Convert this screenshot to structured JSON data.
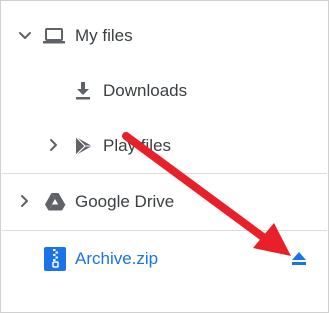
{
  "nav": {
    "my_files": {
      "label": "My files",
      "icon": "laptop-icon",
      "expanded": true
    },
    "downloads": {
      "label": "Downloads",
      "icon": "download-icon"
    },
    "play_files": {
      "label": "Play files",
      "icon": "play-store-icon",
      "expanded": false
    },
    "google_drive": {
      "label": "Google Drive",
      "icon": "drive-icon",
      "expanded": false
    },
    "archive": {
      "label": "Archive.zip",
      "icon": "zip-archive-icon",
      "action_icon": "eject-icon",
      "selected": true
    }
  },
  "colors": {
    "text": "#3c4043",
    "icon": "#5f6368",
    "active": "#1a73e8",
    "annotation_arrow": "#e8202a"
  }
}
